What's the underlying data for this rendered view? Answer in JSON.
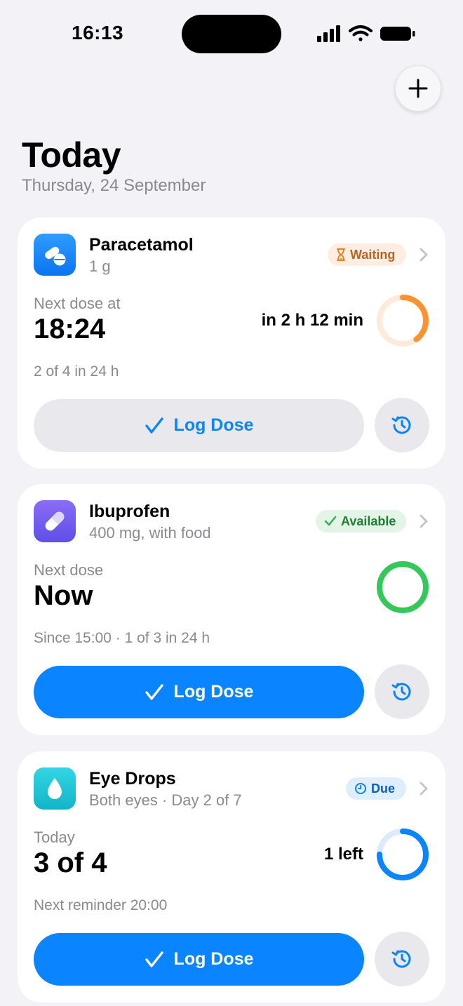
{
  "status_bar": {
    "time": "16:13"
  },
  "header": {
    "title": "Today",
    "date": "Thursday, 24 September"
  },
  "colors": {
    "blue": "#0a84ff",
    "orange": "#ff9230",
    "green": "#34c759",
    "purple": "#6e5cf0",
    "cyan": "#1ec8d8"
  },
  "cards": [
    {
      "name": "Paracetamol",
      "detail": "1 g",
      "icon": "pills-icon",
      "badge": "Waiting",
      "badge_icon": "hourglass-icon",
      "label": "Next dose at",
      "value": "18:24",
      "right_text": "in 2 h 12 min",
      "ring_progress": 0.4,
      "meta": "2 of 4 in 24 h",
      "button": "Log Dose"
    },
    {
      "name": "Ibuprofen",
      "detail": "400 mg, with food",
      "icon": "capsule-icon",
      "badge": "Available",
      "badge_icon": "checkmark-icon",
      "label": "Next dose",
      "value": "Now",
      "right_text": "",
      "ring_progress": 1.0,
      "meta": "Since 15:00 · 1 of 3 in 24 h",
      "button": "Log Dose"
    },
    {
      "name": "Eye Drops",
      "detail": "Both eyes · Day 2 of 7",
      "icon": "drop-icon",
      "badge": "Due",
      "badge_icon": "clock-icon",
      "label": "Today",
      "value": "3 of 4",
      "right_text": "1 left",
      "ring_progress": 0.75,
      "meta": "Next reminder 20:00",
      "button": "Log Dose"
    }
  ]
}
